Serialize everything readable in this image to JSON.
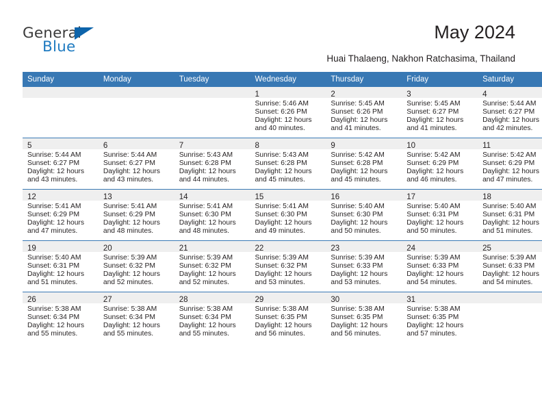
{
  "brand": {
    "name_part1": "General",
    "name_part2": "Blue",
    "triangle_color": "#0d64ab",
    "blue_color": "#1f7bc1"
  },
  "header": {
    "title": "May 2024",
    "subtitle": "Huai Thalaeng, Nakhon Ratchasima, Thailand"
  },
  "theme": {
    "header_bar": "#3878b4",
    "daynum_band": "#efefef",
    "text": "#231f20"
  },
  "calendar": {
    "weekday_headers": [
      "Sunday",
      "Monday",
      "Tuesday",
      "Wednesday",
      "Thursday",
      "Friday",
      "Saturday"
    ],
    "weeks": [
      [
        {
          "day": "",
          "empty": true
        },
        {
          "day": "",
          "empty": true
        },
        {
          "day": "",
          "empty": true
        },
        {
          "day": "1",
          "sunrise": "Sunrise: 5:46 AM",
          "sunset": "Sunset: 6:26 PM",
          "daylight_line1": "Daylight: 12 hours",
          "daylight_line2": "and 40 minutes."
        },
        {
          "day": "2",
          "sunrise": "Sunrise: 5:45 AM",
          "sunset": "Sunset: 6:26 PM",
          "daylight_line1": "Daylight: 12 hours",
          "daylight_line2": "and 41 minutes."
        },
        {
          "day": "3",
          "sunrise": "Sunrise: 5:45 AM",
          "sunset": "Sunset: 6:27 PM",
          "daylight_line1": "Daylight: 12 hours",
          "daylight_line2": "and 41 minutes."
        },
        {
          "day": "4",
          "sunrise": "Sunrise: 5:44 AM",
          "sunset": "Sunset: 6:27 PM",
          "daylight_line1": "Daylight: 12 hours",
          "daylight_line2": "and 42 minutes."
        }
      ],
      [
        {
          "day": "5",
          "sunrise": "Sunrise: 5:44 AM",
          "sunset": "Sunset: 6:27 PM",
          "daylight_line1": "Daylight: 12 hours",
          "daylight_line2": "and 43 minutes."
        },
        {
          "day": "6",
          "sunrise": "Sunrise: 5:44 AM",
          "sunset": "Sunset: 6:27 PM",
          "daylight_line1": "Daylight: 12 hours",
          "daylight_line2": "and 43 minutes."
        },
        {
          "day": "7",
          "sunrise": "Sunrise: 5:43 AM",
          "sunset": "Sunset: 6:28 PM",
          "daylight_line1": "Daylight: 12 hours",
          "daylight_line2": "and 44 minutes."
        },
        {
          "day": "8",
          "sunrise": "Sunrise: 5:43 AM",
          "sunset": "Sunset: 6:28 PM",
          "daylight_line1": "Daylight: 12 hours",
          "daylight_line2": "and 45 minutes."
        },
        {
          "day": "9",
          "sunrise": "Sunrise: 5:42 AM",
          "sunset": "Sunset: 6:28 PM",
          "daylight_line1": "Daylight: 12 hours",
          "daylight_line2": "and 45 minutes."
        },
        {
          "day": "10",
          "sunrise": "Sunrise: 5:42 AM",
          "sunset": "Sunset: 6:29 PM",
          "daylight_line1": "Daylight: 12 hours",
          "daylight_line2": "and 46 minutes."
        },
        {
          "day": "11",
          "sunrise": "Sunrise: 5:42 AM",
          "sunset": "Sunset: 6:29 PM",
          "daylight_line1": "Daylight: 12 hours",
          "daylight_line2": "and 47 minutes."
        }
      ],
      [
        {
          "day": "12",
          "sunrise": "Sunrise: 5:41 AM",
          "sunset": "Sunset: 6:29 PM",
          "daylight_line1": "Daylight: 12 hours",
          "daylight_line2": "and 47 minutes."
        },
        {
          "day": "13",
          "sunrise": "Sunrise: 5:41 AM",
          "sunset": "Sunset: 6:29 PM",
          "daylight_line1": "Daylight: 12 hours",
          "daylight_line2": "and 48 minutes."
        },
        {
          "day": "14",
          "sunrise": "Sunrise: 5:41 AM",
          "sunset": "Sunset: 6:30 PM",
          "daylight_line1": "Daylight: 12 hours",
          "daylight_line2": "and 48 minutes."
        },
        {
          "day": "15",
          "sunrise": "Sunrise: 5:41 AM",
          "sunset": "Sunset: 6:30 PM",
          "daylight_line1": "Daylight: 12 hours",
          "daylight_line2": "and 49 minutes."
        },
        {
          "day": "16",
          "sunrise": "Sunrise: 5:40 AM",
          "sunset": "Sunset: 6:30 PM",
          "daylight_line1": "Daylight: 12 hours",
          "daylight_line2": "and 50 minutes."
        },
        {
          "day": "17",
          "sunrise": "Sunrise: 5:40 AM",
          "sunset": "Sunset: 6:31 PM",
          "daylight_line1": "Daylight: 12 hours",
          "daylight_line2": "and 50 minutes."
        },
        {
          "day": "18",
          "sunrise": "Sunrise: 5:40 AM",
          "sunset": "Sunset: 6:31 PM",
          "daylight_line1": "Daylight: 12 hours",
          "daylight_line2": "and 51 minutes."
        }
      ],
      [
        {
          "day": "19",
          "sunrise": "Sunrise: 5:40 AM",
          "sunset": "Sunset: 6:31 PM",
          "daylight_line1": "Daylight: 12 hours",
          "daylight_line2": "and 51 minutes."
        },
        {
          "day": "20",
          "sunrise": "Sunrise: 5:39 AM",
          "sunset": "Sunset: 6:32 PM",
          "daylight_line1": "Daylight: 12 hours",
          "daylight_line2": "and 52 minutes."
        },
        {
          "day": "21",
          "sunrise": "Sunrise: 5:39 AM",
          "sunset": "Sunset: 6:32 PM",
          "daylight_line1": "Daylight: 12 hours",
          "daylight_line2": "and 52 minutes."
        },
        {
          "day": "22",
          "sunrise": "Sunrise: 5:39 AM",
          "sunset": "Sunset: 6:32 PM",
          "daylight_line1": "Daylight: 12 hours",
          "daylight_line2": "and 53 minutes."
        },
        {
          "day": "23",
          "sunrise": "Sunrise: 5:39 AM",
          "sunset": "Sunset: 6:33 PM",
          "daylight_line1": "Daylight: 12 hours",
          "daylight_line2": "and 53 minutes."
        },
        {
          "day": "24",
          "sunrise": "Sunrise: 5:39 AM",
          "sunset": "Sunset: 6:33 PM",
          "daylight_line1": "Daylight: 12 hours",
          "daylight_line2": "and 54 minutes."
        },
        {
          "day": "25",
          "sunrise": "Sunrise: 5:39 AM",
          "sunset": "Sunset: 6:33 PM",
          "daylight_line1": "Daylight: 12 hours",
          "daylight_line2": "and 54 minutes."
        }
      ],
      [
        {
          "day": "26",
          "sunrise": "Sunrise: 5:38 AM",
          "sunset": "Sunset: 6:34 PM",
          "daylight_line1": "Daylight: 12 hours",
          "daylight_line2": "and 55 minutes."
        },
        {
          "day": "27",
          "sunrise": "Sunrise: 5:38 AM",
          "sunset": "Sunset: 6:34 PM",
          "daylight_line1": "Daylight: 12 hours",
          "daylight_line2": "and 55 minutes."
        },
        {
          "day": "28",
          "sunrise": "Sunrise: 5:38 AM",
          "sunset": "Sunset: 6:34 PM",
          "daylight_line1": "Daylight: 12 hours",
          "daylight_line2": "and 55 minutes."
        },
        {
          "day": "29",
          "sunrise": "Sunrise: 5:38 AM",
          "sunset": "Sunset: 6:35 PM",
          "daylight_line1": "Daylight: 12 hours",
          "daylight_line2": "and 56 minutes."
        },
        {
          "day": "30",
          "sunrise": "Sunrise: 5:38 AM",
          "sunset": "Sunset: 6:35 PM",
          "daylight_line1": "Daylight: 12 hours",
          "daylight_line2": "and 56 minutes."
        },
        {
          "day": "31",
          "sunrise": "Sunrise: 5:38 AM",
          "sunset": "Sunset: 6:35 PM",
          "daylight_line1": "Daylight: 12 hours",
          "daylight_line2": "and 57 minutes."
        },
        {
          "day": "",
          "empty": true
        }
      ]
    ]
  }
}
